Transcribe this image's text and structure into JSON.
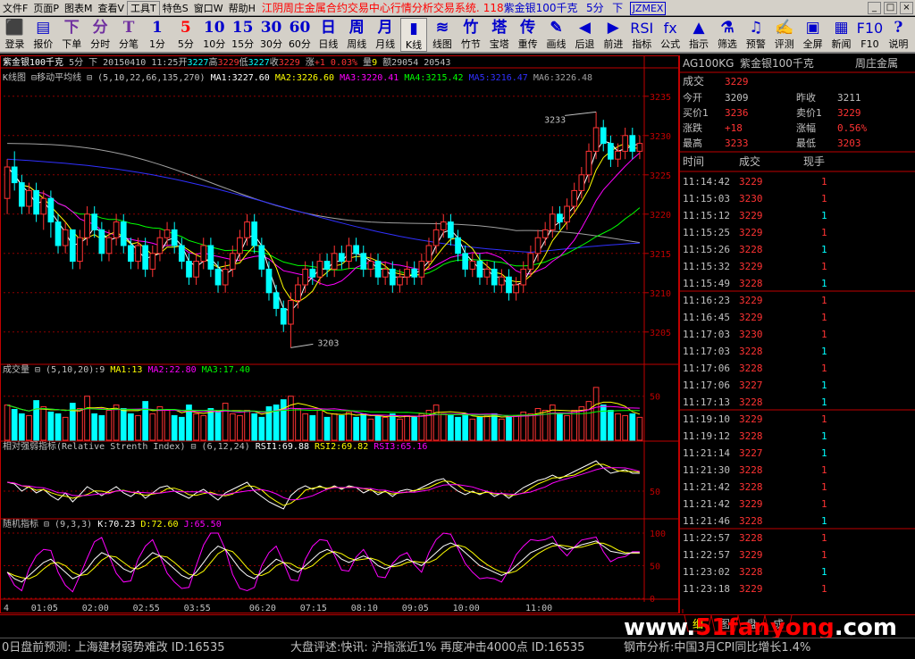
{
  "menubar": {
    "items": [
      "文件F",
      "页面P",
      "图表M",
      "查看V",
      "工具T",
      "特色S",
      "窗口W",
      "帮助H"
    ],
    "title": "江阴周庄金属合约交易中心行情分析交易系统.",
    "code_num": "118",
    "market_title": "紫金银100千克",
    "period": "5分",
    "down_label": "下",
    "code_box": "JZMEX",
    "win_btns": [
      "_",
      "□",
      "×"
    ]
  },
  "toolbar": [
    {
      "icon": "⬛",
      "label": "登录",
      "name": "login"
    },
    {
      "icon": "▤",
      "label": "报价",
      "name": "quote"
    },
    {
      "icon": "下",
      "label": "下单",
      "name": "order"
    },
    {
      "icon": "分",
      "label": "分时",
      "name": "timeshare"
    },
    {
      "icon": "T",
      "label": "分笔",
      "name": "tick"
    },
    {
      "icon": "1",
      "label": "1分",
      "name": "1min"
    },
    {
      "icon": "5",
      "label": "5分",
      "name": "5min"
    },
    {
      "icon": "10",
      "label": "10分",
      "name": "10min"
    },
    {
      "icon": "15",
      "label": "15分",
      "name": "15min"
    },
    {
      "icon": "30",
      "label": "30分",
      "name": "30min"
    },
    {
      "icon": "60",
      "label": "60分",
      "name": "60min"
    },
    {
      "icon": "日",
      "label": "日线",
      "name": "day"
    },
    {
      "icon": "周",
      "label": "周线",
      "name": "week"
    },
    {
      "icon": "月",
      "label": "月线",
      "name": "month"
    },
    {
      "icon": "▮",
      "label": "K线",
      "name": "kline"
    },
    {
      "icon": "≋",
      "label": "线图",
      "name": "linechart"
    },
    {
      "icon": "竹",
      "label": "竹节",
      "name": "bamboo"
    },
    {
      "icon": "塔",
      "label": "宝塔",
      "name": "tower"
    },
    {
      "icon": "传",
      "label": "重传",
      "name": "retransmit"
    },
    {
      "icon": "✎",
      "label": "画线",
      "name": "drawline"
    },
    {
      "icon": "◀",
      "label": "后退",
      "name": "back"
    },
    {
      "icon": "▶",
      "label": "前进",
      "name": "forward"
    },
    {
      "icon": "RSI",
      "label": "指标",
      "name": "indicator"
    },
    {
      "icon": "fx",
      "label": "公式",
      "name": "formula"
    },
    {
      "icon": "▲",
      "label": "指示",
      "name": "indicate"
    },
    {
      "icon": "⚗",
      "label": "筛选",
      "name": "filter"
    },
    {
      "icon": "♫",
      "label": "预警",
      "name": "alert"
    },
    {
      "icon": "✍",
      "label": "评测",
      "name": "evaluate"
    },
    {
      "icon": "▣",
      "label": "全屏",
      "name": "fullscreen"
    },
    {
      "icon": "▦",
      "label": "新闻",
      "name": "news"
    },
    {
      "icon": "F10",
      "label": "F10",
      "name": "f10"
    },
    {
      "icon": "?",
      "label": "说明",
      "name": "help"
    }
  ],
  "chart_header": {
    "name": "紫金银100千克",
    "period": "5分",
    "down": "下",
    "date": "20150410",
    "time": "11:25",
    "open_label": "开",
    "open_val": "3227",
    "high_label": "高",
    "high_val": "3229",
    "low_label": "低",
    "low_val": "3227",
    "close_label": "收",
    "close_val": "3229",
    "chg_label": "涨",
    "chg_val": "+1",
    "pct_val": "0.03%",
    "vol_label": "量",
    "vol_val": "9",
    "amt_label": "额",
    "amt_val": "29054",
    "oi_val": "20543"
  },
  "ma_line": {
    "label": "K线图",
    "ind_name": "移动平均线",
    "params": "(5,10,22,66,135,270)",
    "ma1": "MA1:3227.60",
    "ma2": "MA2:3226.60",
    "ma3": "MA3:3220.41",
    "ma4": "MA4:3215.42",
    "ma5": "MA5:3216.47",
    "ma6": "MA6:3226.48"
  },
  "vol_line": {
    "label": "成交量",
    "params": "(5,10,20)",
    "v": ":9",
    "ma1": "MA1:13",
    "ma2": "MA2:22.80",
    "ma3": "MA3:17.40"
  },
  "rsi_line": {
    "label": "相对强弱指标(Relative Strenth Index)",
    "params": "(6,12,24)",
    "r1": "RSI1:69.88",
    "r2": "RSI2:69.82",
    "r3": "RSI3:65.16"
  },
  "kdj_line": {
    "label": "随机指标",
    "params": "(9,3,3)",
    "k": "K:70.23",
    "d": "D:72.60",
    "j": "J:65.50"
  },
  "price_axis": [
    "3235",
    "3230",
    "3225",
    "3220",
    "3215",
    "3210",
    "3205"
  ],
  "vol_axis": [
    "50"
  ],
  "rsi_axis": [
    "50"
  ],
  "kdj_axis": [
    "100",
    "50",
    "0"
  ],
  "time_axis": [
    "4",
    "01:05",
    "02:00",
    "02:55",
    "03:55",
    "06:20",
    "07:15",
    "08:10",
    "09:05",
    "10:00",
    "11:00"
  ],
  "annotations": {
    "high": "3233",
    "low": "3203"
  },
  "quote_panel": {
    "code": "AG100KG",
    "name": "紫金银100千克",
    "exchange": "周庄金属",
    "deal_label": "成交",
    "deal_val": "3229",
    "rows": [
      {
        "l1": "今开",
        "v1": "3209",
        "l2": "昨收",
        "v2": "3211"
      },
      {
        "l1": "买价1",
        "v1": "3236",
        "l2": "卖价1",
        "v2": "3229"
      },
      {
        "l1": "涨跌",
        "v1": "+18",
        "l2": "涨幅",
        "v2": "0.56%"
      },
      {
        "l1": "最高",
        "v1": "3233",
        "l2": "最低",
        "v2": "3203"
      }
    ],
    "tick_headers": [
      "时间",
      "成交",
      "现手"
    ],
    "ticks": [
      {
        "t": "11:14:42",
        "p": "3229",
        "q": "1",
        "dir": "up"
      },
      {
        "t": "11:15:03",
        "p": "3230",
        "q": "1",
        "dir": "up"
      },
      {
        "t": "11:15:12",
        "p": "3229",
        "q": "1",
        "dir": "down"
      },
      {
        "t": "11:15:25",
        "p": "3229",
        "q": "1",
        "dir": "up"
      },
      {
        "t": "11:15:26",
        "p": "3228",
        "q": "1",
        "dir": "down"
      },
      {
        "t": "11:15:32",
        "p": "3229",
        "q": "1",
        "dir": "up"
      },
      {
        "t": "11:15:49",
        "p": "3228",
        "q": "1",
        "dir": "down"
      },
      {
        "t": "11:16:23",
        "p": "3229",
        "q": "1",
        "dir": "up"
      },
      {
        "t": "11:16:45",
        "p": "3229",
        "q": "1",
        "dir": "up"
      },
      {
        "t": "11:17:03",
        "p": "3230",
        "q": "1",
        "dir": "up"
      },
      {
        "t": "11:17:03",
        "p": "3228",
        "q": "1",
        "dir": "down"
      },
      {
        "t": "11:17:06",
        "p": "3228",
        "q": "1",
        "dir": "up"
      },
      {
        "t": "11:17:06",
        "p": "3227",
        "q": "1",
        "dir": "down"
      },
      {
        "t": "11:17:13",
        "p": "3228",
        "q": "1",
        "dir": "down"
      },
      {
        "t": "11:19:10",
        "p": "3229",
        "q": "1",
        "dir": "up"
      },
      {
        "t": "11:19:12",
        "p": "3228",
        "q": "1",
        "dir": "down"
      },
      {
        "t": "11:21:14",
        "p": "3227",
        "q": "1",
        "dir": "down"
      },
      {
        "t": "11:21:30",
        "p": "3228",
        "q": "1",
        "dir": "up"
      },
      {
        "t": "11:21:42",
        "p": "3228",
        "q": "1",
        "dir": "up"
      },
      {
        "t": "11:21:42",
        "p": "3229",
        "q": "1",
        "dir": "up"
      },
      {
        "t": "11:21:46",
        "p": "3228",
        "q": "1",
        "dir": "down"
      },
      {
        "t": "11:22:57",
        "p": "3228",
        "q": "1",
        "dir": "up"
      },
      {
        "t": "11:22:57",
        "p": "3229",
        "q": "1",
        "dir": "up"
      },
      {
        "t": "11:23:02",
        "p": "3228",
        "q": "1",
        "dir": "down"
      },
      {
        "t": "11:23:18",
        "p": "3229",
        "q": "1",
        "dir": "up"
      }
    ]
  },
  "bottom_tabs": [
    "细",
    "图",
    "盘",
    "成"
  ],
  "watermark": {
    "pre": "www.",
    "main": "51fanyong",
    "post": ".com"
  },
  "ticker": {
    "left": "0日盘前预测: 上海建材弱势难改 ID:16535",
    "middle": "大盘评述:快讯: 沪指涨近1% 再度冲击4000点 ID:16535",
    "right": "钢市分析:中国3月CPI同比增长1.4%"
  },
  "colors": {
    "up": "#ff3333",
    "down": "#00ffff",
    "ma1": "#ffffff",
    "ma2": "#ffff00",
    "ma3": "#ff00ff",
    "ma4": "#00ff00",
    "ma5": "#3030ff",
    "ma6": "#a0a0a0",
    "grid": "#8b0000",
    "axis": "#c00000"
  },
  "chart_data": {
    "type": "candlestick",
    "price_ylim": [
      3201,
      3236
    ],
    "candles": [
      [
        3222,
        3226,
        3227,
        3220
      ],
      [
        3226,
        3224,
        3228,
        3223
      ],
      [
        3224,
        3221,
        3225,
        3220
      ],
      [
        3221,
        3223,
        3224,
        3220
      ],
      [
        3223,
        3220,
        3224,
        3219
      ],
      [
        3220,
        3222,
        3223,
        3218
      ],
      [
        3222,
        3219,
        3223,
        3217
      ],
      [
        3219,
        3216,
        3220,
        3215
      ],
      [
        3216,
        3218,
        3219,
        3215
      ],
      [
        3218,
        3214,
        3218,
        3213
      ],
      [
        3214,
        3217,
        3218,
        3213
      ],
      [
        3217,
        3220,
        3221,
        3216
      ],
      [
        3220,
        3218,
        3221,
        3217
      ],
      [
        3218,
        3215,
        3219,
        3214
      ],
      [
        3215,
        3217,
        3218,
        3214
      ],
      [
        3217,
        3219,
        3220,
        3216
      ],
      [
        3219,
        3216,
        3220,
        3215
      ],
      [
        3216,
        3214,
        3217,
        3213
      ],
      [
        3214,
        3216,
        3217,
        3213
      ],
      [
        3216,
        3213,
        3217,
        3212
      ],
      [
        3213,
        3215,
        3216,
        3212
      ],
      [
        3215,
        3217,
        3218,
        3214
      ],
      [
        3217,
        3218,
        3219,
        3216
      ],
      [
        3218,
        3216,
        3219,
        3215
      ],
      [
        3216,
        3214,
        3217,
        3213
      ],
      [
        3214,
        3212,
        3215,
        3211
      ],
      [
        3212,
        3214,
        3215,
        3211
      ],
      [
        3214,
        3216,
        3217,
        3213
      ],
      [
        3216,
        3213,
        3217,
        3212
      ],
      [
        3213,
        3211,
        3214,
        3210
      ],
      [
        3211,
        3213,
        3214,
        3210
      ],
      [
        3213,
        3215,
        3216,
        3212
      ],
      [
        3215,
        3217,
        3218,
        3214
      ],
      [
        3217,
        3219,
        3220,
        3216
      ],
      [
        3219,
        3216,
        3220,
        3215
      ],
      [
        3216,
        3213,
        3217,
        3212
      ],
      [
        3213,
        3210,
        3214,
        3209
      ],
      [
        3210,
        3208,
        3211,
        3207
      ],
      [
        3208,
        3206,
        3209,
        3205
      ],
      [
        3206,
        3209,
        3210,
        3203
      ],
      [
        3209,
        3211,
        3212,
        3208
      ],
      [
        3211,
        3213,
        3214,
        3210
      ],
      [
        3213,
        3212,
        3214,
        3211
      ],
      [
        3212,
        3214,
        3215,
        3211
      ],
      [
        3214,
        3213,
        3215,
        3212
      ],
      [
        3213,
        3215,
        3216,
        3212
      ],
      [
        3215,
        3214,
        3216,
        3213
      ],
      [
        3214,
        3216,
        3217,
        3213
      ],
      [
        3216,
        3215,
        3217,
        3214
      ],
      [
        3215,
        3213,
        3216,
        3212
      ],
      [
        3213,
        3214,
        3215,
        3212
      ],
      [
        3214,
        3212,
        3215,
        3211
      ],
      [
        3212,
        3213,
        3214,
        3211
      ],
      [
        3213,
        3211,
        3214,
        3210
      ],
      [
        3211,
        3212,
        3213,
        3210
      ],
      [
        3212,
        3213,
        3214,
        3211
      ],
      [
        3213,
        3212,
        3214,
        3211
      ],
      [
        3212,
        3214,
        3215,
        3211
      ],
      [
        3214,
        3216,
        3217,
        3213
      ],
      [
        3216,
        3218,
        3219,
        3215
      ],
      [
        3218,
        3219,
        3220,
        3217
      ],
      [
        3219,
        3217,
        3220,
        3216
      ],
      [
        3217,
        3215,
        3218,
        3214
      ],
      [
        3215,
        3213,
        3216,
        3212
      ],
      [
        3213,
        3214,
        3215,
        3212
      ],
      [
        3214,
        3212,
        3215,
        3211
      ],
      [
        3212,
        3213,
        3214,
        3211
      ],
      [
        3213,
        3211,
        3214,
        3210
      ],
      [
        3211,
        3212,
        3213,
        3210
      ],
      [
        3212,
        3210,
        3213,
        3209
      ],
      [
        3210,
        3211,
        3212,
        3209
      ],
      [
        3211,
        3213,
        3214,
        3210
      ],
      [
        3213,
        3215,
        3216,
        3212
      ],
      [
        3215,
        3217,
        3218,
        3214
      ],
      [
        3217,
        3218,
        3219,
        3216
      ],
      [
        3218,
        3220,
        3221,
        3217
      ],
      [
        3220,
        3219,
        3221,
        3218
      ],
      [
        3219,
        3221,
        3222,
        3218
      ],
      [
        3221,
        3223,
        3224,
        3220
      ],
      [
        3223,
        3225,
        3226,
        3222
      ],
      [
        3225,
        3228,
        3229,
        3224
      ],
      [
        3228,
        3231,
        3233,
        3227
      ],
      [
        3231,
        3229,
        3232,
        3228
      ],
      [
        3229,
        3227,
        3230,
        3226
      ],
      [
        3227,
        3228,
        3229,
        3226
      ],
      [
        3228,
        3230,
        3231,
        3227
      ],
      [
        3230,
        3228,
        3231,
        3227
      ],
      [
        3228,
        3229,
        3230,
        3227
      ]
    ],
    "volumes": [
      40,
      35,
      30,
      28,
      45,
      38,
      32,
      30,
      26,
      42,
      36,
      50,
      30,
      28,
      34,
      40,
      36,
      30,
      28,
      44,
      30,
      38,
      34,
      28,
      26,
      40,
      30,
      28,
      36,
      32,
      42,
      30,
      28,
      34,
      30,
      26,
      38,
      40,
      46,
      50,
      36,
      30,
      28,
      34,
      26,
      30,
      28,
      32,
      26,
      30,
      24,
      28,
      26,
      30,
      24,
      28,
      26,
      30,
      34,
      40,
      30,
      28,
      26,
      30,
      24,
      26,
      28,
      30,
      24,
      26,
      28,
      32,
      30,
      36,
      34,
      40,
      30,
      28,
      34,
      38,
      44,
      60,
      40,
      34,
      30,
      28,
      30,
      26
    ],
    "rsi1": [
      60,
      58,
      50,
      55,
      48,
      52,
      45,
      40,
      48,
      38,
      46,
      55,
      50,
      45,
      50,
      55,
      48,
      44,
      50,
      42,
      48,
      54,
      56,
      50,
      46,
      42,
      48,
      52,
      46,
      40,
      48,
      52,
      56,
      60,
      50,
      44,
      38,
      34,
      30,
      45,
      52,
      56,
      52,
      56,
      52,
      56,
      52,
      56,
      54,
      48,
      52,
      46,
      50,
      44,
      50,
      52,
      50,
      54,
      58,
      62,
      64,
      56,
      50,
      46,
      50,
      46,
      50,
      44,
      48,
      42,
      48,
      54,
      58,
      62,
      64,
      68,
      64,
      68,
      72,
      76,
      80,
      84,
      76,
      70,
      72,
      74,
      70,
      70
    ],
    "kdj_k": [
      40,
      30,
      25,
      35,
      45,
      55,
      60,
      50,
      40,
      30,
      35,
      45,
      60,
      70,
      65,
      55,
      45,
      40,
      50,
      60,
      70,
      65,
      55,
      45,
      35,
      30,
      40,
      55,
      70,
      80,
      75,
      60,
      45,
      35,
      30,
      40,
      50,
      60,
      55,
      45,
      40,
      50,
      60,
      70,
      75,
      70,
      60,
      55,
      60,
      65,
      60,
      50,
      45,
      50,
      55,
      60,
      55,
      50,
      60,
      70,
      80,
      85,
      80,
      70,
      60,
      50,
      45,
      40,
      35,
      40,
      50,
      60,
      70,
      75,
      80,
      85,
      80,
      75,
      78,
      82,
      85,
      88,
      80,
      72,
      70,
      68,
      70,
      70
    ]
  }
}
